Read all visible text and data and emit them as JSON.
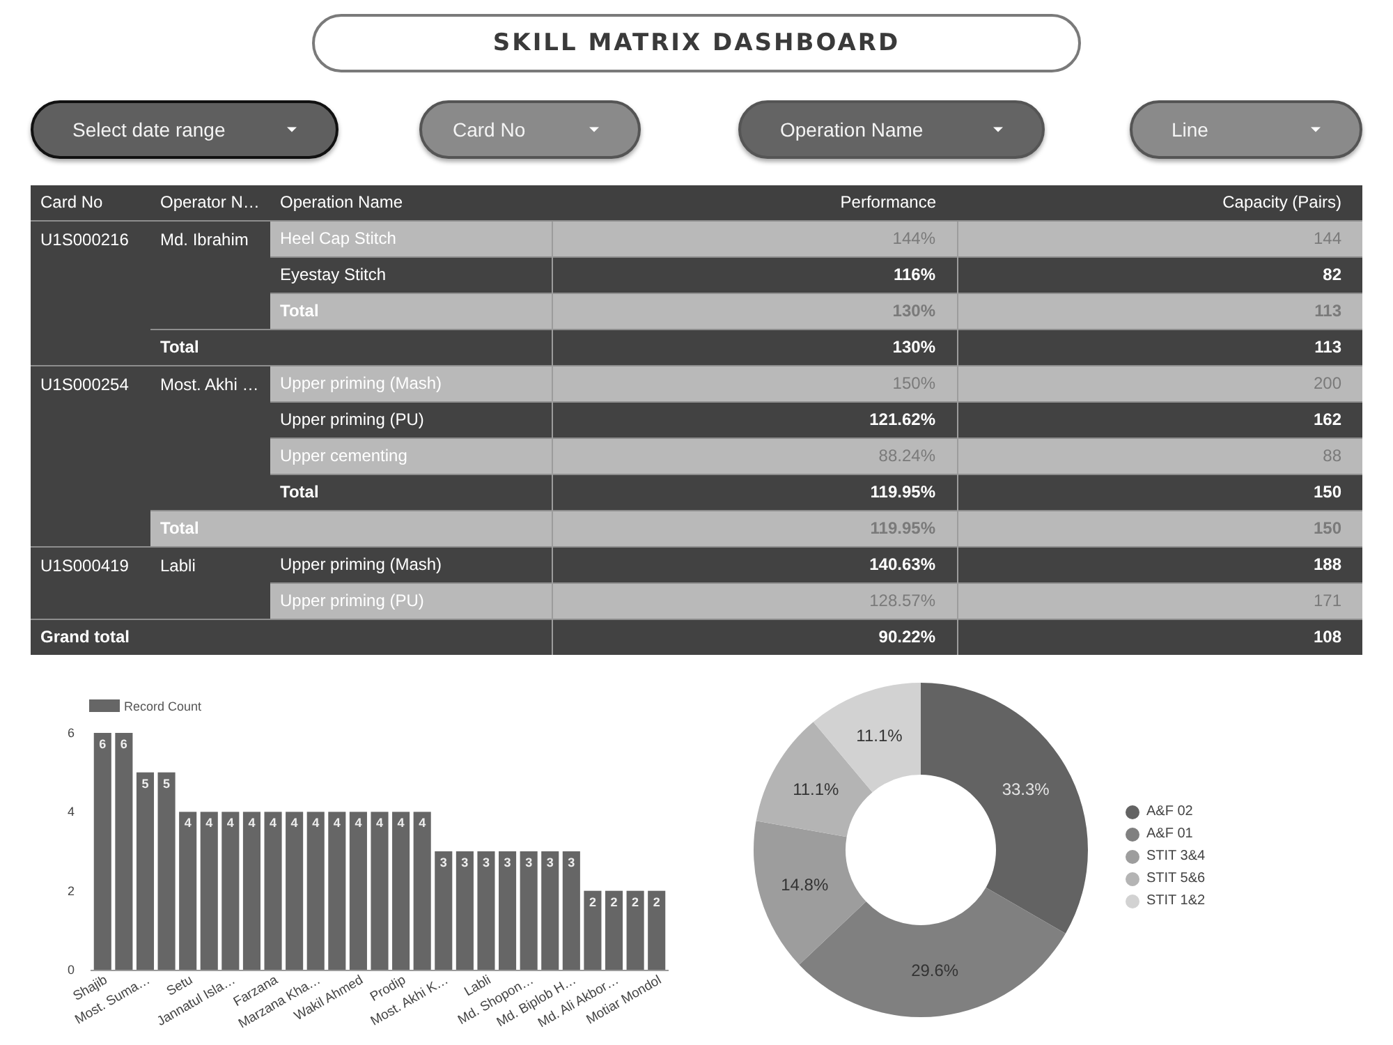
{
  "title": "SKILL MATRIX DASHBOARD",
  "filters": [
    {
      "kind": "date_range",
      "label": "Select date range",
      "color": "#5f5f5f"
    },
    {
      "kind": "dropdown",
      "label": "Card No",
      "color": "#8a8a8a"
    },
    {
      "kind": "dropdown",
      "label": "Operation Name",
      "color": "#646464"
    },
    {
      "kind": "dropdown",
      "label": "Line",
      "color": "#8a8a8a"
    }
  ],
  "table": {
    "columns": [
      "Card No",
      "Operator N…",
      "Operation Name",
      "Performance",
      "Capacity (Pairs)"
    ],
    "groups": [
      {
        "card_no": "U1S000216",
        "operator": "Md. Ibrahim",
        "rows": [
          {
            "kind": "item",
            "operation": "Heel Cap Stitch",
            "performance": "144%",
            "capacity": "144"
          },
          {
            "kind": "item",
            "operation": "Eyestay Stitch",
            "performance": "116%",
            "capacity": "82"
          },
          {
            "kind": "total",
            "operation": "Total",
            "performance": "130%",
            "capacity": "113"
          }
        ],
        "total": {
          "label": "Total",
          "performance": "130%",
          "capacity": "113"
        }
      },
      {
        "card_no": "U1S000254",
        "operator": "Most. Akhi …",
        "rows": [
          {
            "kind": "item",
            "operation": "Upper priming (Mash)",
            "performance": "150%",
            "capacity": "200"
          },
          {
            "kind": "item",
            "operation": "Upper priming (PU)",
            "performance": "121.62%",
            "capacity": "162"
          },
          {
            "kind": "item",
            "operation": "Upper cementing",
            "performance": "88.24%",
            "capacity": "88"
          },
          {
            "kind": "total",
            "operation": "Total",
            "performance": "119.95%",
            "capacity": "150"
          }
        ],
        "total": {
          "label": "Total",
          "performance": "119.95%",
          "capacity": "150"
        }
      },
      {
        "card_no": "U1S000419",
        "operator": "Labli",
        "rows": [
          {
            "kind": "item",
            "operation": "Upper priming (Mash)",
            "performance": "140.63%",
            "capacity": "188"
          },
          {
            "kind": "item",
            "operation": "Upper priming (PU)",
            "performance": "128.57%",
            "capacity": "171"
          }
        ]
      }
    ],
    "grand_total": {
      "label": "Grand total",
      "performance": "90.22%",
      "capacity": "108"
    }
  },
  "bar_chart": {
    "chart_data": {
      "type": "bar",
      "categories": [
        "Shajib",
        null,
        "Most. Suma…",
        null,
        "Setu",
        null,
        "Jannatul Isla…",
        null,
        "Farzana",
        null,
        "Marzana Kha…",
        null,
        "Wakil Ahmed",
        null,
        "Prodip",
        null,
        "Most. Akhi K…",
        null,
        "Labli",
        null,
        "Md. Shopon…",
        null,
        "Md. Biplob H…",
        null,
        "Md. Ali Akbor…",
        null,
        "Motiar Mondol"
      ],
      "series": [
        {
          "name": "Record Count",
          "color": "#666666",
          "values": [
            6,
            6,
            5,
            5,
            4,
            4,
            4,
            4,
            4,
            4,
            4,
            4,
            4,
            4,
            4,
            4,
            3,
            3,
            3,
            3,
            3,
            3,
            3,
            2,
            2,
            2,
            2
          ]
        }
      ],
      "ylim": [
        0,
        6
      ],
      "yticks": [
        0,
        2,
        4,
        6
      ],
      "data_labels": true
    }
  },
  "donut_chart": {
    "chart_data": {
      "type": "donut",
      "categories": [
        "A&F 02",
        "A&F 01",
        "STIT 3&4",
        "STIT 5&6",
        "STIT 1&2"
      ],
      "values": [
        33.3,
        29.6,
        14.8,
        11.1,
        11.1
      ],
      "colors": [
        "#636363",
        "#808080",
        "#9d9d9d",
        "#b4b4b4",
        "#d2d2d2"
      ],
      "value_labels": [
        "33.3%",
        "29.6%",
        "14.8%",
        "11.1%",
        "11.1%"
      ]
    }
  }
}
